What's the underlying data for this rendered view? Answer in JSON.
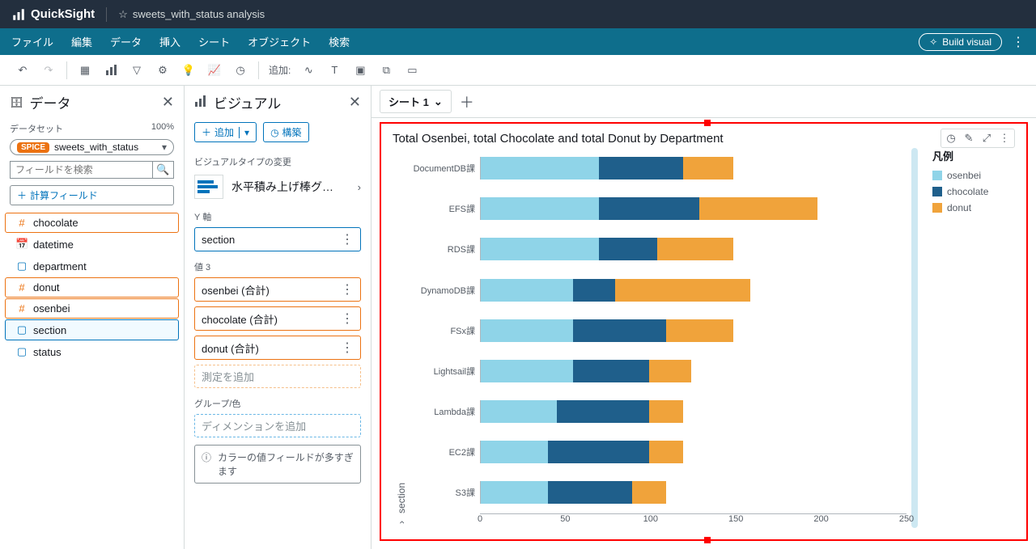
{
  "brand": "QuickSight",
  "analysis_title": "sweets_with_status analysis",
  "menu": {
    "items": [
      "ファイル",
      "編集",
      "データ",
      "挿入",
      "シート",
      "オブジェクト",
      "検索"
    ],
    "build_visual": "Build visual"
  },
  "toolbar": {
    "add_label": "追加:"
  },
  "data_panel": {
    "heading": "データ",
    "dataset_label": "データセット",
    "pct": "100%",
    "spice": "SPICE",
    "dataset_name": "sweets_with_status",
    "search_placeholder": "フィールドを検索",
    "calc_field": "計算フィールド",
    "fields": [
      {
        "name": "chocolate",
        "kind": "num"
      },
      {
        "name": "datetime",
        "kind": "date"
      },
      {
        "name": "department",
        "kind": "dim-plain"
      },
      {
        "name": "donut",
        "kind": "num"
      },
      {
        "name": "osenbei",
        "kind": "num"
      },
      {
        "name": "section",
        "kind": "dim"
      },
      {
        "name": "status",
        "kind": "dim-plain"
      }
    ]
  },
  "visual_panel": {
    "heading": "ビジュアル",
    "add": "追加",
    "build": "構築",
    "chart_type_label": "ビジュアルタイプの変更",
    "chart_type": "水平積み上げ棒グ…",
    "y_axis_label": "Y 軸",
    "y_axis_value": "section",
    "values_label": "値  3",
    "values": [
      "osenbei (合計)",
      "chocolate (合計)",
      "donut (合計)"
    ],
    "add_measure": "測定を追加",
    "group_label": "グループ/色",
    "add_dimension": "ディメンションを追加",
    "tooltip": "カラーの値フィールドが多すぎます"
  },
  "sheet": {
    "name": "シート 1"
  },
  "chart_title": "Total Osenbei, total Chocolate and total Donut by Department",
  "ylabel": "section",
  "legend": {
    "title": "凡例",
    "items": [
      "osenbei",
      "chocolate",
      "donut"
    ]
  },
  "colors": {
    "osenbei": "#8fd4e8",
    "chocolate": "#1f5f8b",
    "donut": "#f0a33b"
  },
  "x_ticks": [
    0,
    50,
    100,
    150,
    200,
    250
  ],
  "chart_data": {
    "type": "bar",
    "orientation": "horizontal",
    "stacked": true,
    "title": "Total Osenbei, total Chocolate and total Donut by Department",
    "xlabel": "",
    "ylabel": "section",
    "xlim": [
      0,
      250
    ],
    "categories": [
      "DocumentDB課",
      "EFS課",
      "RDS課",
      "DynamoDB課",
      "FSx課",
      "Lightsail課",
      "Lambda課",
      "EC2課",
      "S3課"
    ],
    "series": [
      {
        "name": "osenbei",
        "values": [
          70,
          70,
          70,
          55,
          55,
          55,
          45,
          40,
          40
        ]
      },
      {
        "name": "chocolate",
        "values": [
          50,
          60,
          35,
          25,
          55,
          45,
          55,
          60,
          50
        ]
      },
      {
        "name": "donut",
        "values": [
          30,
          70,
          45,
          80,
          40,
          25,
          20,
          20,
          20
        ]
      }
    ],
    "legend_position": "right"
  }
}
